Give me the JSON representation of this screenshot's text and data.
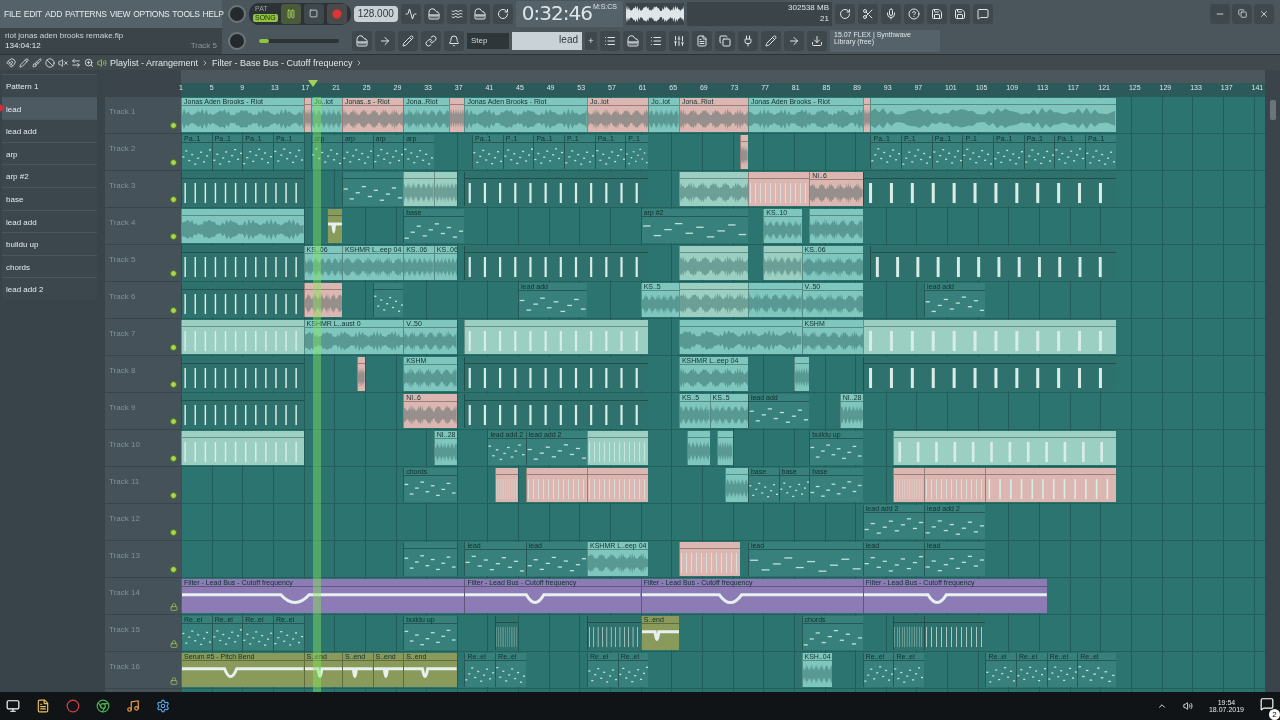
{
  "menu": [
    "FILE",
    "EDIT",
    "ADD",
    "PATTERNS",
    "VIEW",
    "OPTIONS",
    "TOOLS",
    "HELP"
  ],
  "hint": {
    "file": "riot jonas aden brooks remake.flp",
    "time": "134:04:12",
    "target": "Track 5"
  },
  "transport": {
    "modes": [
      {
        "label": "PAT",
        "selected": false
      },
      {
        "label": "SONG",
        "selected": true
      }
    ],
    "tempo": "128.000",
    "clock": "0:32:46",
    "clock_unit": "M:S:CS"
  },
  "pitch": {
    "level": 0.12
  },
  "monitor": {
    "cpu": "30",
    "memory": "2538 MB",
    "polyphony": "21"
  },
  "snap": "Step",
  "pattern": "lead",
  "pattern_add": "+",
  "news": {
    "line1": "15.07  FLEX | Synthwave",
    "line2": "Library (free)"
  },
  "playlist": {
    "title": "Playlist - Arrangement",
    "target": "Filter - Base Bus - Cutoff frequency",
    "ruler": [
      "1",
      "5",
      "9",
      "13",
      "17",
      "21",
      "25",
      "29",
      "33",
      "37",
      "41",
      "45",
      "49",
      "53",
      "57",
      "61",
      "65",
      "69",
      "73",
      "77",
      "81",
      "85",
      "89",
      "93",
      "97",
      "101",
      "105",
      "109",
      "113",
      "117",
      "121",
      "125",
      "129",
      "133",
      "137",
      "141"
    ],
    "playhead": {
      "level": 0.122
    },
    "patterns": [
      {
        "label": "Pattern 1",
        "selected": false
      },
      {
        "label": "lead",
        "selected": true
      },
      {
        "label": "lead add",
        "selected": false
      },
      {
        "label": "arp",
        "selected": false
      },
      {
        "label": "arp #2",
        "selected": false
      },
      {
        "label": "base",
        "selected": false
      },
      {
        "label": "lead add",
        "selected": false
      },
      {
        "label": "buildu up",
        "selected": false
      },
      {
        "label": "chords",
        "selected": false
      },
      {
        "label": "lead add 2",
        "selected": false
      }
    ],
    "tracks": [
      {
        "name": "Track 1",
        "locked": false,
        "clips": [
          {
            "label": "Jonas Aden  Brooks - Riot",
            "kind": "audio",
            "color": "#7fc7be"
          },
          {
            "kind": "audio",
            "color": "#dcb7b1"
          },
          {
            "label": "Jo..iot",
            "kind": "audio",
            "color": "#7fc7be"
          },
          {
            "label": "Jonas..s - Riot",
            "kind": "audio",
            "color": "#dcb7b1"
          },
          {
            "label": "Jona..Riot",
            "kind": "audio",
            "color": "#7fc7be"
          },
          {
            "kind": "audio",
            "color": "#dcb7b1"
          },
          {
            "label": "Jonas Aden  Brooks - Riot",
            "kind": "audio",
            "color": "#7fc7be"
          },
          {
            "label": "Jo..iot",
            "kind": "audio",
            "color": "#dcb7b1"
          },
          {
            "label": "Jo..iot",
            "kind": "audio",
            "color": "#7fc7be"
          },
          {
            "label": "Jona..Riot",
            "kind": "audio",
            "color": "#dcb7b1"
          },
          {
            "label": "Jonas Aden  Brooks - Riot",
            "kind": "audio",
            "color": "#7fc7be"
          },
          {
            "kind": "audio",
            "color": "#dcb7b1"
          },
          {
            "kind": "audio",
            "color": "#7fc7be"
          }
        ]
      },
      {
        "name": "Track 2",
        "locked": false,
        "clips": [
          {
            "label": "Pa..1",
            "kind": "pattern",
            "color": "#37807b"
          },
          {
            "label": "Pa..1",
            "kind": "pattern",
            "color": "#37807b"
          },
          {
            "label": "Pa..1",
            "kind": "pattern",
            "color": "#37807b"
          },
          {
            "label": "Pa..1",
            "kind": "pattern",
            "color": "#37807b"
          },
          {
            "label": "arp",
            "kind": "pattern",
            "color": "#37807b"
          },
          {
            "label": "arp",
            "kind": "pattern",
            "color": "#37807b"
          },
          {
            "label": "arp",
            "kind": "pattern",
            "color": "#37807b"
          },
          {
            "label": "arp",
            "kind": "pattern",
            "color": "#37807b"
          },
          {
            "label": "Pa..1",
            "kind": "pattern",
            "color": "#37807b"
          },
          {
            "label": "P..1",
            "kind": "pattern",
            "color": "#37807b"
          },
          {
            "label": "Pa..1",
            "kind": "pattern",
            "color": "#37807b"
          },
          {
            "label": "P..1",
            "kind": "pattern",
            "color": "#37807b"
          },
          {
            "label": "Pa..1",
            "kind": "pattern",
            "color": "#37807b"
          },
          {
            "label": "P..1",
            "kind": "pattern",
            "color": "#37807b"
          },
          {
            "kind": "audio",
            "color": "#dcb7b1"
          },
          {
            "label": "Pa..1",
            "kind": "pattern",
            "color": "#37807b"
          },
          {
            "label": "P..1",
            "kind": "pattern",
            "color": "#37807b"
          },
          {
            "label": "Pa..1",
            "kind": "pattern",
            "color": "#37807b"
          },
          {
            "label": "P..1",
            "kind": "pattern",
            "color": "#37807b"
          },
          {
            "label": "Pa..1",
            "kind": "pattern",
            "color": "#37807b"
          },
          {
            "label": "Pa..1",
            "kind": "pattern",
            "color": "#37807b"
          },
          {
            "label": "Pa..1",
            "kind": "pattern",
            "color": "#37807b"
          },
          {
            "label": "Pa..1",
            "kind": "pattern",
            "color": "#37807b"
          }
        ]
      },
      {
        "name": "Track 3",
        "locked": false,
        "clips": [
          {
            "kind": "hits",
            "color": "#2f716d"
          },
          {
            "kind": "pattern",
            "color": "#37807b"
          },
          {
            "kind": "audio",
            "color": "#9bcfc2"
          },
          {
            "kind": "audio",
            "color": "#9bcfc2"
          },
          {
            "kind": "hits",
            "color": "#2f716d"
          },
          {
            "kind": "audio",
            "color": "#9bcfc2"
          },
          {
            "kind": "hits",
            "color": "#dcb7b1"
          },
          {
            "label": "NI..6",
            "kind": "audio",
            "color": "#dcb7b1"
          },
          {
            "kind": "hits",
            "color": "#2f716d"
          }
        ]
      },
      {
        "name": "Track 4",
        "locked": false,
        "clips": [
          {
            "kind": "audio",
            "color": "#7fc7be"
          },
          {
            "kind": "automation",
            "color": "#8a9a5b"
          },
          {
            "label": "base",
            "kind": "pattern",
            "color": "#37807b"
          },
          {
            "label": "arp #2",
            "kind": "pattern",
            "color": "#37807b"
          },
          {
            "label": "KS..10",
            "kind": "audio",
            "color": "#7fc7be"
          },
          {
            "kind": "audio",
            "color": "#7fc7be"
          }
        ]
      },
      {
        "name": "Track 5",
        "locked": false,
        "clips": [
          {
            "kind": "hits",
            "color": "#2f716d"
          },
          {
            "label": "KS..06",
            "kind": "audio",
            "color": "#7fc7be"
          },
          {
            "label": "KSHMR L..eep 04",
            "kind": "audio",
            "color": "#7fc7be"
          },
          {
            "label": "KS..06",
            "kind": "audio",
            "color": "#7fc7be"
          },
          {
            "label": "KS..06",
            "kind": "audio",
            "color": "#7fc7be"
          },
          {
            "kind": "hits",
            "color": "#2f716d"
          },
          {
            "kind": "audio",
            "color": "#9bcfc2"
          },
          {
            "kind": "audio",
            "color": "#9bcfc2"
          },
          {
            "label": "KS..06",
            "kind": "audio",
            "color": "#7fc7be"
          },
          {
            "kind": "hits",
            "color": "#2f716d"
          }
        ]
      },
      {
        "name": "Track 6",
        "locked": false,
        "clips": [
          {
            "kind": "hits",
            "color": "#2f716d"
          },
          {
            "kind": "audio",
            "color": "#dcb7b1"
          },
          {
            "kind": "pattern",
            "color": "#37807b"
          },
          {
            "label": "lead add",
            "kind": "pattern",
            "color": "#37807b"
          },
          {
            "label": "KS..5",
            "kind": "audio",
            "color": "#7fc7be"
          },
          {
            "kind": "audio",
            "color": "#9bcfc2"
          },
          {
            "kind": "audio",
            "color": "#7fc7be"
          },
          {
            "label": "V..50",
            "kind": "audio",
            "color": "#7fc7be"
          },
          {
            "label": "lead add",
            "kind": "pattern",
            "color": "#37807b"
          }
        ]
      },
      {
        "name": "Track 7",
        "locked": false,
        "clips": [
          {
            "kind": "hits",
            "color": "#9bcfc2"
          },
          {
            "label": "KSHMR L..aust 0",
            "kind": "audio",
            "color": "#7fc7be"
          },
          {
            "label": "V..50",
            "kind": "audio",
            "color": "#7fc7be"
          },
          {
            "kind": "hits",
            "color": "#9bcfc2"
          },
          {
            "kind": "audio",
            "color": "#7fc7be"
          },
          {
            "label": "KSHM",
            "kind": "audio",
            "color": "#7fc7be"
          },
          {
            "kind": "hits",
            "color": "#9bcfc2"
          }
        ]
      },
      {
        "name": "Track 8",
        "locked": false,
        "clips": [
          {
            "kind": "hits",
            "color": "#2f716d"
          },
          {
            "kind": "audio",
            "color": "#dcb7b1"
          },
          {
            "label": "KSHM",
            "kind": "audio",
            "color": "#7fc7be"
          },
          {
            "kind": "hits",
            "color": "#2f716d"
          },
          {
            "label": "KSHMR L..eep 04",
            "kind": "audio",
            "color": "#7fc7be"
          },
          {
            "kind": "audio",
            "color": "#7fc7be"
          },
          {
            "kind": "hits",
            "color": "#2f716d"
          }
        ]
      },
      {
        "name": "Track 9",
        "locked": false,
        "clips": [
          {
            "kind": "hits",
            "color": "#2f716d"
          },
          {
            "label": "NI..6",
            "kind": "audio",
            "color": "#dcb7b1"
          },
          {
            "kind": "hits",
            "color": "#2f716d"
          },
          {
            "label": "KS..5",
            "kind": "audio",
            "color": "#7fc7be"
          },
          {
            "label": "KS..5",
            "kind": "audio",
            "color": "#7fc7be"
          },
          {
            "label": "lead add",
            "kind": "pattern",
            "color": "#37807b"
          },
          {
            "label": "NI..28",
            "kind": "audio",
            "color": "#7fc7be"
          }
        ]
      },
      {
        "name": "Track 10",
        "locked": false,
        "clips": [
          {
            "kind": "hits",
            "color": "#9bcfc2"
          },
          {
            "label": "NI..28",
            "kind": "audio",
            "color": "#7fc7be"
          },
          {
            "label": "lead add 2",
            "kind": "pattern",
            "color": "#37807b"
          },
          {
            "label": "lead add 2",
            "kind": "pattern",
            "color": "#37807b"
          },
          {
            "kind": "hits",
            "color": "#9bcfc2"
          },
          {
            "kind": "audio",
            "color": "#7fc7be"
          },
          {
            "kind": "audio",
            "color": "#7fc7be"
          },
          {
            "label": "buildu up",
            "kind": "pattern",
            "color": "#37807b"
          },
          {
            "kind": "hits",
            "color": "#9bcfc2"
          }
        ]
      },
      {
        "name": "Track 11",
        "locked": false,
        "clips": [
          {
            "label": "chords",
            "kind": "pattern",
            "color": "#37807b"
          },
          {
            "kind": "hits",
            "color": "#dcb7b1"
          },
          {
            "kind": "hits",
            "color": "#dcb7b1"
          },
          {
            "kind": "hits",
            "color": "#dcb7b1"
          },
          {
            "kind": "audio",
            "color": "#7fc7be"
          },
          {
            "label": "base",
            "kind": "pattern",
            "color": "#37807b"
          },
          {
            "label": "base",
            "kind": "pattern",
            "color": "#37807b"
          },
          {
            "label": "base",
            "kind": "pattern",
            "color": "#37807b"
          },
          {
            "kind": "hits",
            "color": "#dcb7b1"
          },
          {
            "kind": "hits",
            "color": "#dcb7b1"
          },
          {
            "kind": "hits",
            "color": "#dcb7b1"
          }
        ]
      },
      {
        "name": "Track 12",
        "locked": false,
        "clips": [
          {
            "label": "lead add 2",
            "kind": "pattern",
            "color": "#37807b"
          },
          {
            "label": "lead add 2",
            "kind": "pattern",
            "color": "#37807b"
          }
        ]
      },
      {
        "name": "Track 13",
        "locked": false,
        "clips": [
          {
            "kind": "pattern",
            "color": "#37807b"
          },
          {
            "label": "lead",
            "kind": "pattern",
            "color": "#37807b"
          },
          {
            "label": "lead",
            "kind": "pattern",
            "color": "#37807b"
          },
          {
            "label": "KSHMR L..eep 04",
            "kind": "audio",
            "color": "#7fc7be"
          },
          {
            "kind": "hits",
            "color": "#dcb7b1"
          },
          {
            "label": "lead",
            "kind": "pattern",
            "color": "#37807b"
          },
          {
            "label": "lead",
            "kind": "pattern",
            "color": "#37807b"
          },
          {
            "label": "lead",
            "kind": "pattern",
            "color": "#37807b"
          }
        ]
      },
      {
        "name": "Track 14",
        "locked": true,
        "clips": [
          {
            "label": "Filter - Lead Bus - Cutoff frequency",
            "kind": "automation",
            "color": "#8c7bb5"
          },
          {
            "label": "Filter - Lead Bus - Cutoff frequency",
            "kind": "automation",
            "color": "#8c7bb5"
          },
          {
            "label": "Filter - Lead Bus - Cutoff frequency",
            "kind": "automation",
            "color": "#8c7bb5"
          },
          {
            "label": "Filter - Lead Bus - Cutoff frequency",
            "kind": "automation",
            "color": "#8c7bb5"
          }
        ]
      },
      {
        "name": "Track 15",
        "locked": true,
        "clips": [
          {
            "label": "Re..el",
            "kind": "pattern",
            "color": "#37807b"
          },
          {
            "label": "Re..el",
            "kind": "pattern",
            "color": "#37807b"
          },
          {
            "label": "Re..el",
            "kind": "pattern",
            "color": "#37807b"
          },
          {
            "label": "Re..el",
            "kind": "pattern",
            "color": "#37807b"
          },
          {
            "label": "buildu up",
            "kind": "pattern",
            "color": "#37807b"
          },
          {
            "kind": "hits",
            "color": "#2f716d"
          },
          {
            "kind": "hits",
            "color": "#2f716d"
          },
          {
            "label": "S..end",
            "kind": "automation",
            "color": "#8a9a5b"
          },
          {
            "label": "chords",
            "kind": "pattern",
            "color": "#37807b"
          },
          {
            "kind": "hits",
            "color": "#2f716d"
          },
          {
            "kind": "hits",
            "color": "#2f716d"
          }
        ]
      },
      {
        "name": "Track 16",
        "locked": true,
        "clips": [
          {
            "label": "Serum #5 - Pitch Bend",
            "kind": "automation",
            "color": "#8a9a5b"
          },
          {
            "label": "S..end",
            "kind": "automation",
            "color": "#8a9a5b"
          },
          {
            "label": "S..end",
            "kind": "automation",
            "color": "#8a9a5b"
          },
          {
            "label": "S..end",
            "kind": "automation",
            "color": "#8a9a5b"
          },
          {
            "label": "S..end",
            "kind": "automation",
            "color": "#8a9a5b"
          },
          {
            "label": "Re..el",
            "kind": "pattern",
            "color": "#37807b"
          },
          {
            "label": "Re..el",
            "kind": "pattern",
            "color": "#37807b"
          },
          {
            "label": "Re..el",
            "kind": "pattern",
            "color": "#37807b"
          },
          {
            "label": "Re..el",
            "kind": "pattern",
            "color": "#37807b"
          },
          {
            "label": "KSH..04",
            "kind": "audio",
            "color": "#7fc7be"
          },
          {
            "label": "Re..el",
            "kind": "pattern",
            "color": "#37807b"
          },
          {
            "label": "Re..el",
            "kind": "pattern",
            "color": "#37807b"
          },
          {
            "label": "Re..el",
            "kind": "pattern",
            "color": "#37807b"
          },
          {
            "label": "Re..el",
            "kind": "pattern",
            "color": "#37807b"
          },
          {
            "label": "Re..el",
            "kind": "pattern",
            "color": "#37807b"
          },
          {
            "label": "Re..el",
            "kind": "pattern",
            "color": "#37807b"
          }
        ]
      }
    ]
  },
  "taskbar": {
    "time": "19:54",
    "date": "18.07.2019",
    "notifications": "2"
  }
}
